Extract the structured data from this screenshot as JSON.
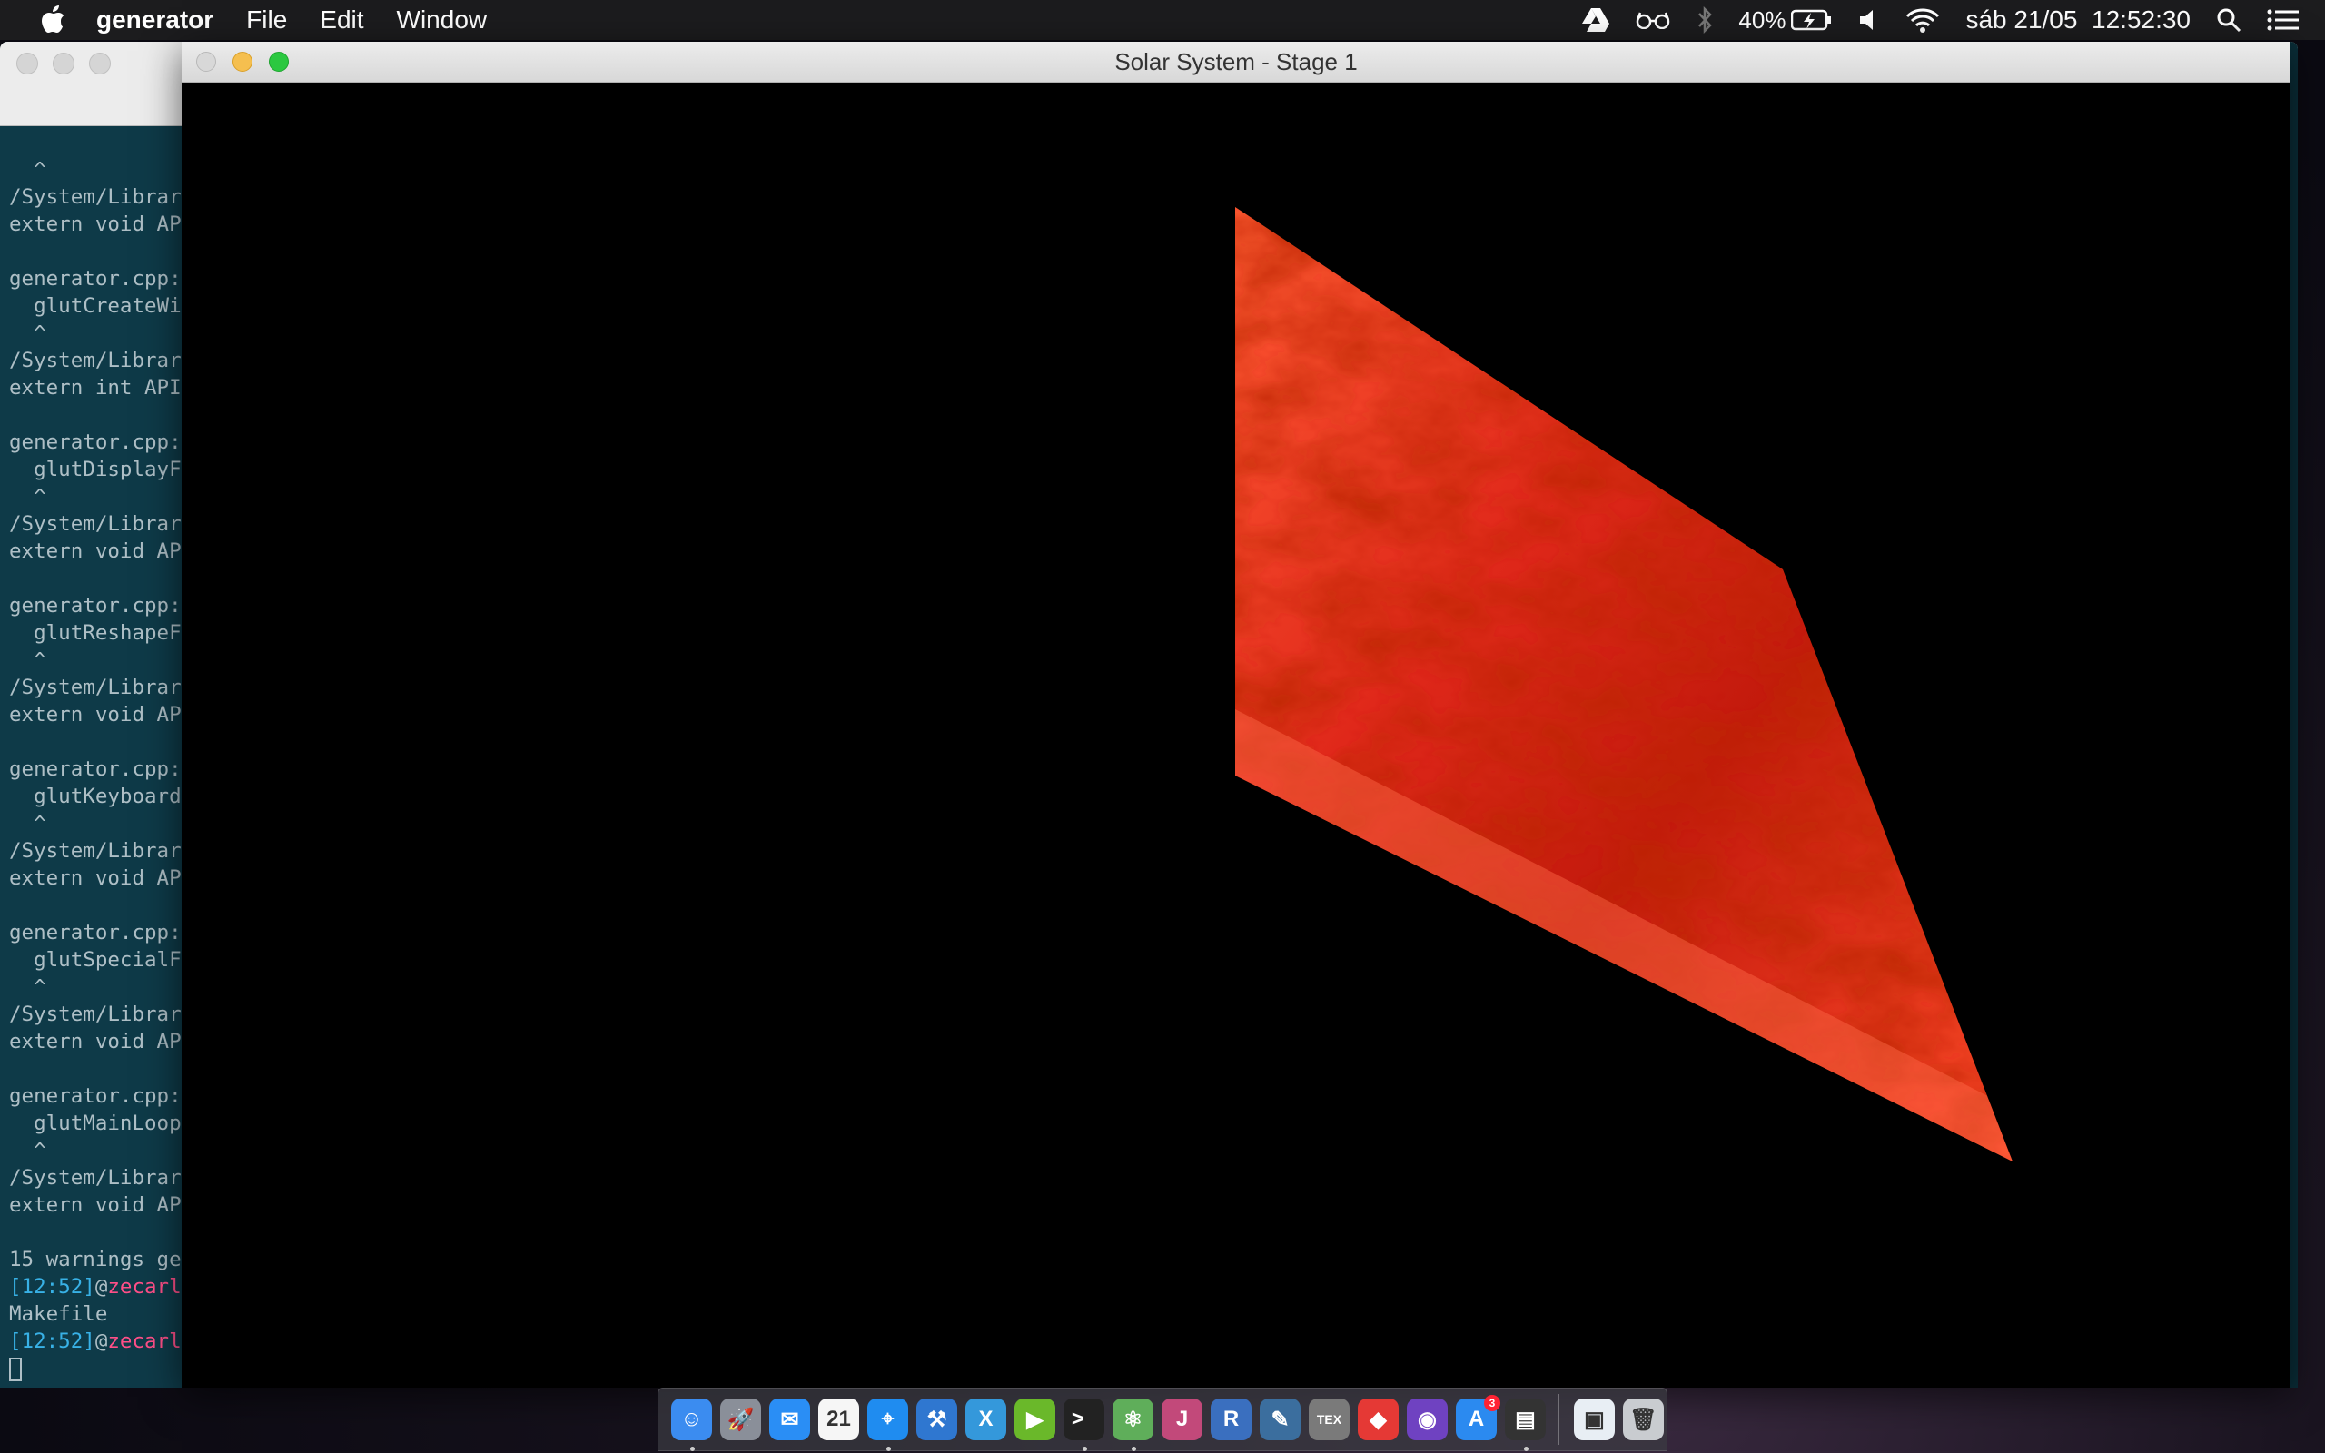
{
  "menubar": {
    "app_name": "generator",
    "menus": [
      "File",
      "Edit",
      "Window"
    ],
    "status": {
      "battery": "40%",
      "datetime": "sáb 21/05  12:52:30"
    }
  },
  "gl_window": {
    "title": "Solar System - Stage 1"
  },
  "terminal": {
    "lines": [
      {
        "t": "  ^"
      },
      {
        "t": "/System/Librar"
      },
      {
        "t": "extern void AP"
      },
      {
        "t": ""
      },
      {
        "t": "generator.cpp:"
      },
      {
        "t": "  glutCreateWi"
      },
      {
        "t": "  ^"
      },
      {
        "t": "/System/Librar"
      },
      {
        "t": "extern int API"
      },
      {
        "t": ""
      },
      {
        "t": "generator.cpp:"
      },
      {
        "t": "  glutDisplayF"
      },
      {
        "t": "  ^"
      },
      {
        "t": "/System/Librar"
      },
      {
        "t": "extern void AP"
      },
      {
        "t": ""
      },
      {
        "t": "generator.cpp:"
      },
      {
        "t": "  glutReshapeF"
      },
      {
        "t": "  ^"
      },
      {
        "t": "/System/Librar"
      },
      {
        "t": "extern void AP"
      },
      {
        "t": ""
      },
      {
        "t": "generator.cpp:"
      },
      {
        "t": "  glutKeyboard"
      },
      {
        "t": "  ^"
      },
      {
        "t": "/System/Librar"
      },
      {
        "t": "extern void AP"
      },
      {
        "t": ""
      },
      {
        "t": "generator.cpp:"
      },
      {
        "t": "  glutSpecialF"
      },
      {
        "t": "  ^"
      },
      {
        "t": "/System/Librar"
      },
      {
        "t": "extern void AP"
      },
      {
        "t": ""
      },
      {
        "t": "generator.cpp:"
      },
      {
        "t": "  glutMainLoop"
      },
      {
        "t": "  ^"
      },
      {
        "t": "/System/Librar"
      },
      {
        "t": "extern void AP"
      },
      {
        "t": ""
      },
      {
        "t": "15 warnings ge"
      }
    ],
    "prompt1_time": "[12:52]",
    "prompt1_at": "@",
    "prompt1_host": "zecarlos",
    "output": "Makefile",
    "prompt2_time": "[12:52]",
    "prompt2_at": "@",
    "prompt2_host": "zecarlos"
  },
  "dock": {
    "icons": [
      {
        "name": "finder-icon",
        "glyph": "☺",
        "bg": "#3b8cf0",
        "running": true
      },
      {
        "name": "launchpad-icon",
        "glyph": "🚀",
        "bg": "#8a8f99",
        "running": false
      },
      {
        "name": "mail-icon",
        "glyph": "✉",
        "bg": "#2a8ef5",
        "running": false
      },
      {
        "name": "calendar-icon",
        "glyph": "21",
        "bg": "#f6f6f6",
        "running": false
      },
      {
        "name": "safari-icon",
        "glyph": "⌖",
        "bg": "#1f8cf0",
        "running": true
      },
      {
        "name": "xcode-icon",
        "glyph": "⚒",
        "bg": "#2f77d0",
        "running": false
      },
      {
        "name": "xamarin-icon",
        "glyph": "X",
        "bg": "#3498db",
        "running": false
      },
      {
        "name": "play-icon",
        "glyph": "▶",
        "bg": "#6ab82a",
        "running": false
      },
      {
        "name": "terminal-icon",
        "glyph": ">_",
        "bg": "#222222",
        "running": true
      },
      {
        "name": "atom-icon",
        "glyph": "⚛",
        "bg": "#5fae5a",
        "running": true
      },
      {
        "name": "intellij-icon",
        "glyph": "J",
        "bg": "#c2497a",
        "running": false
      },
      {
        "name": "r-icon",
        "glyph": "R",
        "bg": "#3a6fbf",
        "running": false
      },
      {
        "name": "mysql-workbench-icon",
        "glyph": "✎",
        "bg": "#3b6e9e",
        "running": false
      },
      {
        "name": "tex-icon",
        "glyph": "TEX",
        "bg": "#7a7a7a",
        "running": false
      },
      {
        "name": "git-icon",
        "glyph": "◆",
        "bg": "#e53935",
        "running": false
      },
      {
        "name": "github-icon",
        "glyph": "◉",
        "bg": "#6f42c1",
        "running": false
      },
      {
        "name": "app-store-icon",
        "glyph": "A",
        "bg": "#2b8af0",
        "running": false,
        "badge": "3"
      },
      {
        "name": "console-icon",
        "glyph": "▤",
        "bg": "#333333",
        "running": true
      },
      {
        "name": "saver-icon",
        "glyph": "▣",
        "bg": "#e8eef4",
        "running": false
      },
      {
        "name": "trash-icon",
        "glyph": "🗑",
        "bg": "#c9ccd0",
        "running": false
      }
    ]
  },
  "colors": {
    "planet_light": "#ff5a33",
    "planet_dark": "#b01208",
    "terminal_bg": "#0e3a48"
  }
}
